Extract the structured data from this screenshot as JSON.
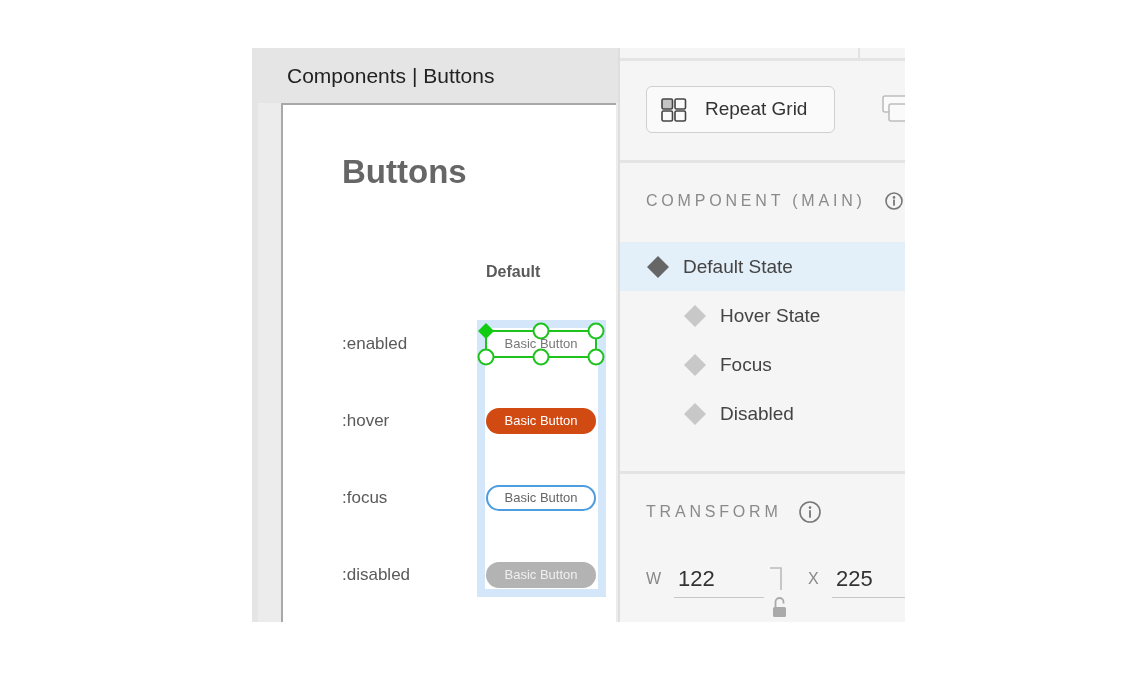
{
  "document_tab": {
    "title": "Components | Buttons"
  },
  "artboard": {
    "title": "Buttons",
    "column_header": "Default",
    "rows": [
      {
        "label": ":enabled",
        "button": {
          "label": "Basic Button",
          "kind": "plain",
          "selected": true
        }
      },
      {
        "label": ":hover",
        "button": {
          "label": "Basic Button",
          "kind": "hover",
          "selected": false
        }
      },
      {
        "label": ":focus",
        "button": {
          "label": "Basic Button",
          "kind": "focus",
          "selected": false
        }
      },
      {
        "label": ":disabled",
        "button": {
          "label": "Basic Button",
          "kind": "disabled",
          "selected": false
        }
      }
    ]
  },
  "inspector": {
    "repeat_grid_button": {
      "label": "Repeat Grid"
    },
    "component": {
      "title": "COMPONENT (MAIN)",
      "states": [
        {
          "label": "Default State",
          "selected": true,
          "children": [
            {
              "label": "Hover State",
              "selected": false
            },
            {
              "label": "Focus",
              "selected": false
            },
            {
              "label": "Disabled",
              "selected": false
            }
          ]
        }
      ]
    },
    "transform": {
      "title": "TRANSFORM",
      "locked": false,
      "fields": [
        {
          "label": "W",
          "value": "122"
        },
        {
          "label": "X",
          "value": "225"
        }
      ]
    }
  }
}
